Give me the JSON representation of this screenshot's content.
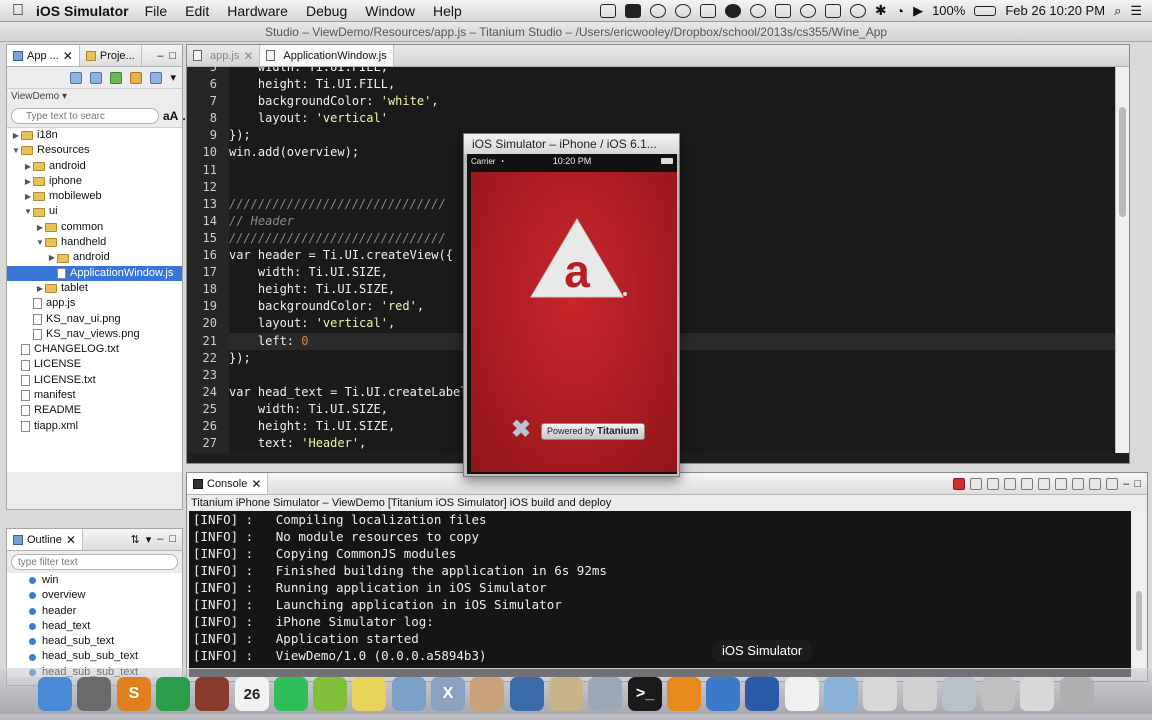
{
  "menubar": {
    "app_name": "iOS Simulator",
    "menus": [
      "File",
      "Edit",
      "Hardware",
      "Debug",
      "Window",
      "Help"
    ],
    "battery": "100%",
    "datetime": "Feb 26  10:20 PM"
  },
  "window_title": "Studio – ViewDemo/Resources/app.js – Titanium Studio – /Users/ericwooley/Dropbox/school/2013s/cs355/Wine_App",
  "left_panel": {
    "tabs": [
      "App ...",
      "Proje..."
    ],
    "project": "ViewDemo",
    "filter_placeholder": "Type text to searc",
    "aa": "aA",
    "tree": [
      {
        "label": "i18n",
        "kind": "folder",
        "depth": 1,
        "arrow": "▶"
      },
      {
        "label": "Resources",
        "kind": "folder",
        "depth": 1,
        "arrow": "▼"
      },
      {
        "label": "android",
        "kind": "folder",
        "depth": 2,
        "arrow": "▶"
      },
      {
        "label": "iphone",
        "kind": "folder",
        "depth": 2,
        "arrow": "▶"
      },
      {
        "label": "mobileweb",
        "kind": "folder",
        "depth": 2,
        "arrow": "▶"
      },
      {
        "label": "ui",
        "kind": "folder",
        "depth": 2,
        "arrow": "▼"
      },
      {
        "label": "common",
        "kind": "folder",
        "depth": 3,
        "arrow": "▶"
      },
      {
        "label": "handheld",
        "kind": "folder",
        "depth": 3,
        "arrow": "▼"
      },
      {
        "label": "android",
        "kind": "folder",
        "depth": 4,
        "arrow": "▶"
      },
      {
        "label": "ApplicationWindow.js",
        "kind": "file",
        "depth": 4,
        "arrow": "",
        "selected": true
      },
      {
        "label": "tablet",
        "kind": "folder",
        "depth": 3,
        "arrow": "▶"
      },
      {
        "label": "app.js",
        "kind": "file",
        "depth": 2,
        "arrow": ""
      },
      {
        "label": "KS_nav_ui.png",
        "kind": "file",
        "depth": 2,
        "arrow": ""
      },
      {
        "label": "KS_nav_views.png",
        "kind": "file",
        "depth": 2,
        "arrow": ""
      },
      {
        "label": "CHANGELOG.txt",
        "kind": "file",
        "depth": 1,
        "arrow": ""
      },
      {
        "label": "LICENSE",
        "kind": "file",
        "depth": 1,
        "arrow": ""
      },
      {
        "label": "LICENSE.txt",
        "kind": "file",
        "depth": 1,
        "arrow": ""
      },
      {
        "label": "manifest",
        "kind": "file",
        "depth": 1,
        "arrow": ""
      },
      {
        "label": "README",
        "kind": "file",
        "depth": 1,
        "arrow": ""
      },
      {
        "label": "tiapp.xml",
        "kind": "file",
        "depth": 1,
        "arrow": ""
      }
    ]
  },
  "outline": {
    "tab": "Outline",
    "filter_placeholder": "type filter text",
    "items": [
      "win",
      "overview",
      "header",
      "head_text",
      "head_sub_text",
      "head_sub_sub_text",
      "head_sub_sub_text"
    ]
  },
  "editor": {
    "tabs": [
      "app.js",
      "ApplicationWindow.js"
    ],
    "line_numbers": [
      "5",
      "6",
      "7",
      "8",
      "9",
      "10",
      "11",
      "12",
      "13",
      "14",
      "15",
      "16",
      "17",
      "18",
      "19",
      "20",
      "21",
      "22",
      "23",
      "24",
      "25",
      "26",
      "27"
    ],
    "lines": [
      "    width: Ti.UI.FILL,",
      "    height: Ti.UI.FILL,",
      "    backgroundColor: 'white',",
      "    layout: 'vertical'",
      "});",
      "win.add(overview);",
      "",
      "",
      "//////////////////////////////",
      "// Header",
      "//////////////////////////////",
      "var header = Ti.UI.createView({",
      "    width: Ti.UI.SIZE,",
      "    height: Ti.UI.SIZE,",
      "    backgroundColor: 'red',",
      "    layout: 'vertical',",
      "    left: 0",
      "});",
      "",
      "var head_text = Ti.UI.createLabel({",
      "    width: Ti.UI.SIZE,",
      "    height: Ti.UI.SIZE,",
      "    text: 'Header',"
    ]
  },
  "console": {
    "tab": "Console",
    "title": "Titanium iPhone Simulator – ViewDemo [Titanium iOS Simulator] iOS build and deploy",
    "log": [
      "[INFO] :   Compiling localization files",
      "[INFO] :   No module resources to copy",
      "[INFO] :   Copying CommonJS modules",
      "[INFO] :   Finished building the application in 6s 92ms",
      "[INFO] :   Running application in iOS Simulator",
      "[INFO] :   Launching application in iOS Simulator",
      "[INFO] :   iPhone Simulator log:",
      "[INFO] :   Application started",
      "[INFO] :   ViewDemo/1.0 (0.0.0.a5894b3)"
    ]
  },
  "simulator": {
    "title": "iOS Simulator – iPhone / iOS 6.1...",
    "carrier": "Carrier",
    "time": "10:20 PM",
    "logo_letter": "a",
    "powered_prefix": "Powered by",
    "powered_brand": "Titanium"
  },
  "dock": {
    "tooltip": "iOS Simulator",
    "calendar_day": "26",
    "icons": [
      {
        "name": "finder-icon",
        "color": "#4a8ad8",
        "glyph": ""
      },
      {
        "name": "launchpad-icon",
        "color": "#6a6a6a",
        "glyph": ""
      },
      {
        "name": "sublime-icon",
        "color": "#e07f1e",
        "glyph": "S"
      },
      {
        "name": "chrome-icon",
        "color": "#2b9c4a",
        "glyph": ""
      },
      {
        "name": "mail-icon",
        "color": "#8a3a2a",
        "glyph": ""
      },
      {
        "name": "calendar-icon",
        "color": "#f2f2f2",
        "glyph": ""
      },
      {
        "name": "facetime-icon",
        "color": "#2fbf5a",
        "glyph": ""
      },
      {
        "name": "android-icon",
        "color": "#7fbf3a",
        "glyph": ""
      },
      {
        "name": "stickies-icon",
        "color": "#e8d25a",
        "glyph": ""
      },
      {
        "name": "preview-icon",
        "color": "#7aa0c8",
        "glyph": ""
      },
      {
        "name": "xcode-icon",
        "color": "#8aa2c0",
        "glyph": "X"
      },
      {
        "name": "user-app-icon",
        "color": "#c8a27a",
        "glyph": ""
      },
      {
        "name": "people-icon",
        "color": "#3a6aa8",
        "glyph": ""
      },
      {
        "name": "database-icon",
        "color": "#c8b48a",
        "glyph": ""
      },
      {
        "name": "photos-icon",
        "color": "#9aa8b8",
        "glyph": ""
      },
      {
        "name": "terminal-icon",
        "color": "#1a1a1a",
        "glyph": "&gt;_"
      },
      {
        "name": "vlc-icon",
        "color": "#e8891e",
        "glyph": ""
      },
      {
        "name": "network-icon",
        "color": "#3a7ac8",
        "glyph": ""
      },
      {
        "name": "ios-simulator-icon",
        "color": "#2a5aa8",
        "glyph": ""
      },
      {
        "name": "document-icon",
        "color": "#f0f0f0",
        "glyph": ""
      },
      {
        "name": "folder-icon",
        "color": "#8ab2d8",
        "glyph": ""
      },
      {
        "name": "mail-folder-icon",
        "color": "#d8d8d8",
        "glyph": ""
      },
      {
        "name": "documents-icon",
        "color": "#d0d0d0",
        "glyph": ""
      },
      {
        "name": "screenshots-icon",
        "color": "#b8c0c8",
        "glyph": ""
      },
      {
        "name": "photo-folder-icon",
        "color": "#c0c0c0",
        "glyph": ""
      },
      {
        "name": "downloads-icon",
        "color": "#d8d8d8",
        "glyph": ""
      },
      {
        "name": "trash-icon",
        "color": "#b0b0b0",
        "glyph": ""
      }
    ]
  }
}
